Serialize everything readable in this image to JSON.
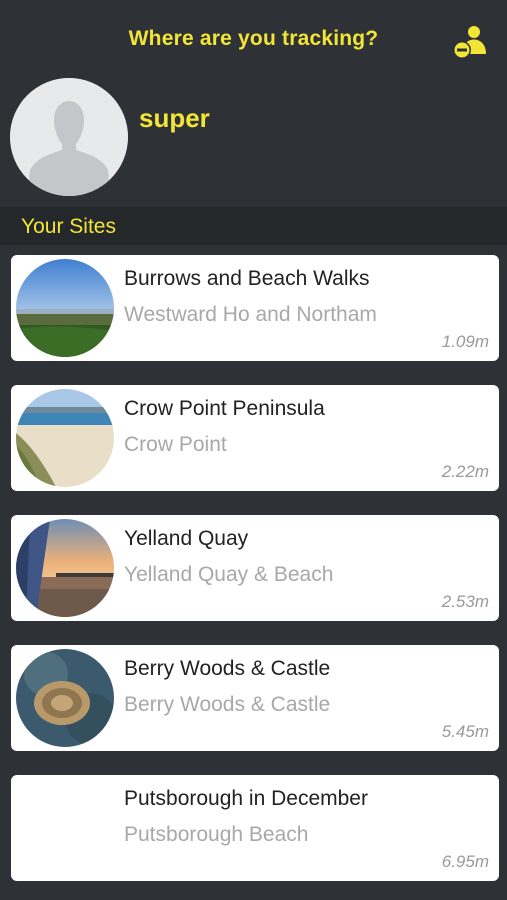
{
  "header": {
    "title": "Where are you tracking?",
    "account_icon": "user-minus-icon"
  },
  "profile": {
    "username": "super",
    "avatar_icon": "person-silhouette-icon"
  },
  "section": {
    "title": "Your Sites"
  },
  "colors": {
    "background": "#2e3135",
    "accent": "#f3e536",
    "card": "#ffffff",
    "section_bar": "#25282b"
  },
  "sites": [
    {
      "name": "Burrows and Beach Walks",
      "location": "Westward Ho and Northam",
      "distance": "1.09m",
      "thumb": "landscape-thumb"
    },
    {
      "name": "Crow Point Peninsula",
      "location": "Crow Point",
      "distance": "2.22m",
      "thumb": "beach-thumb"
    },
    {
      "name": "Yelland Quay",
      "location": "Yelland Quay & Beach",
      "distance": "2.53m",
      "thumb": "quay-sunset-thumb"
    },
    {
      "name": "Berry Woods & Castle",
      "location": "Berry Woods & Castle",
      "distance": "5.45m",
      "thumb": "aerial-woods-thumb"
    },
    {
      "name": "Putsborough in December",
      "location": "Putsborough Beach",
      "distance": "6.95m",
      "thumb": ""
    }
  ]
}
